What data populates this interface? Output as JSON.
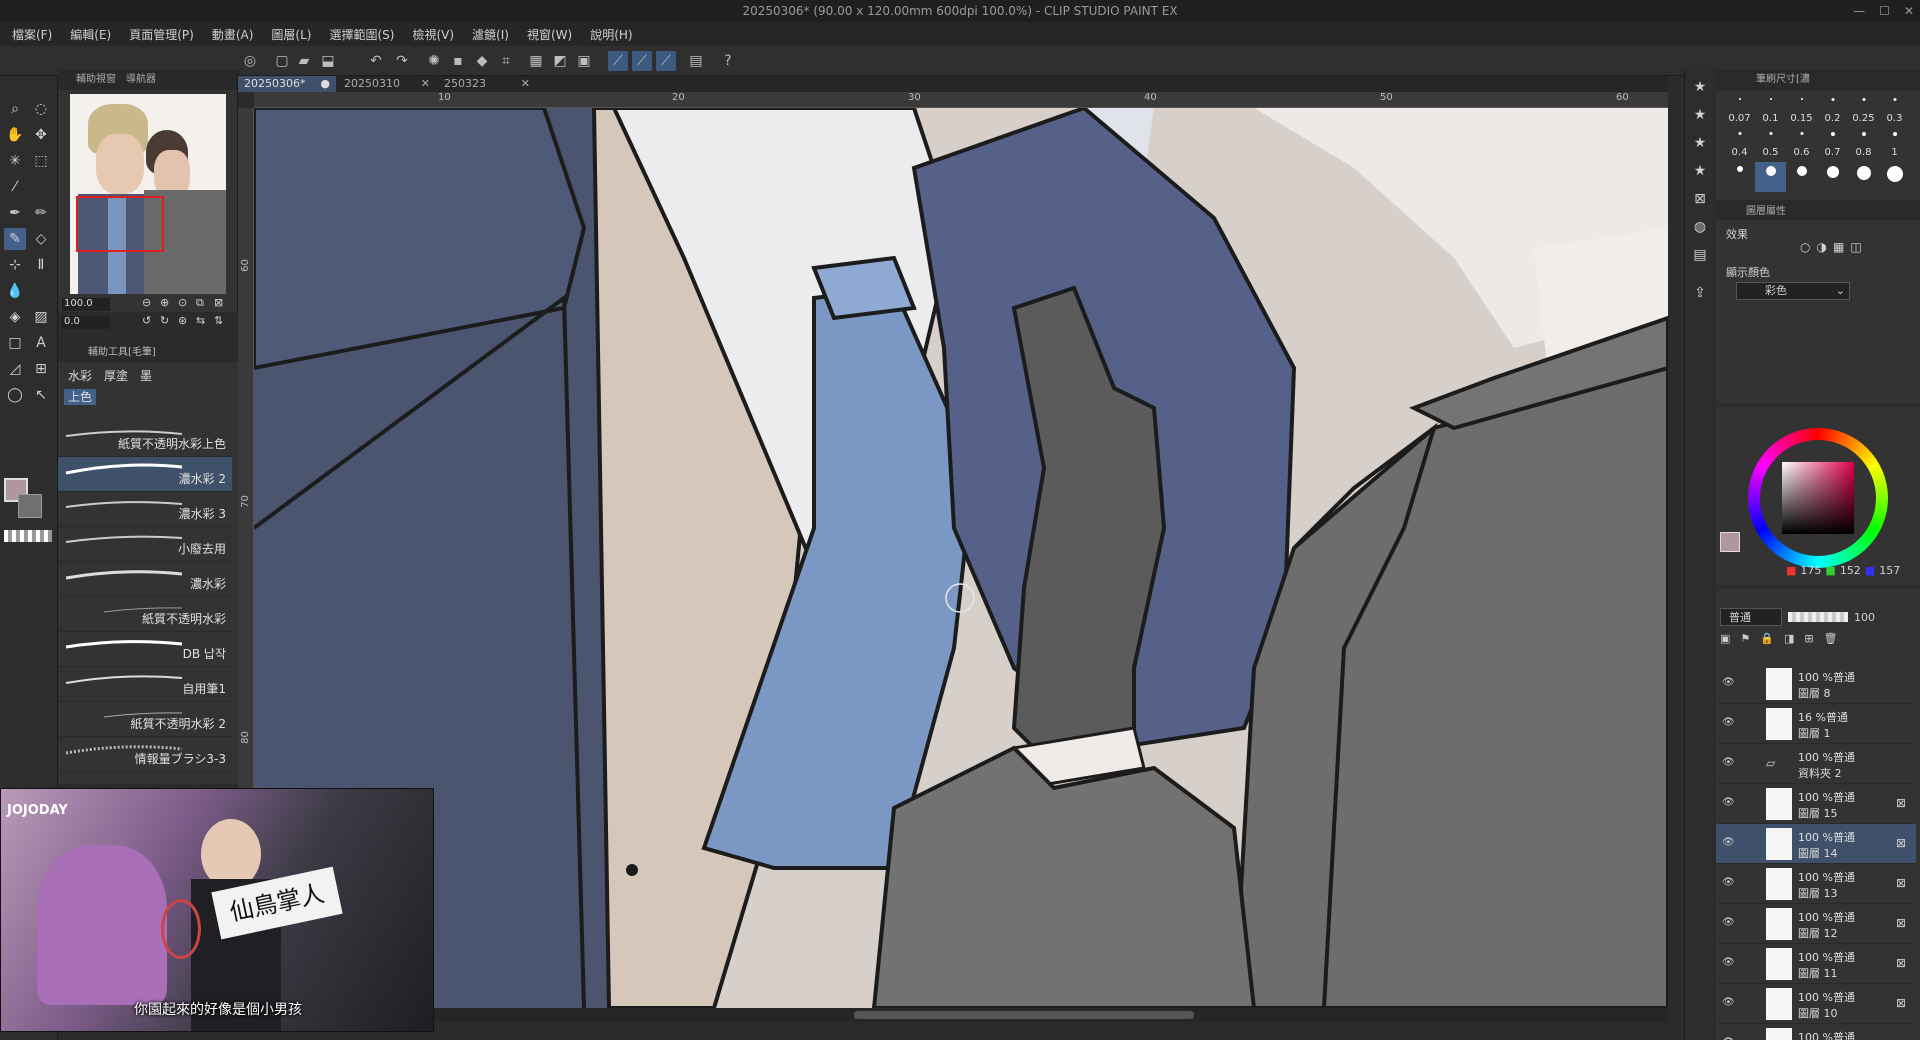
{
  "window": {
    "title": "20250306* (90.00 x 120.00mm 600dpi 100.0%)  - CLIP STUDIO PAINT EX",
    "controls": [
      "—",
      "☐",
      "✕"
    ]
  },
  "menu": [
    "檔案(F)",
    "編輯(E)",
    "頁面管理(P)",
    "動畫(A)",
    "圖層(L)",
    "選擇範圍(S)",
    "檢視(V)",
    "濾鏡(I)",
    "視窗(W)",
    "說明(H)"
  ],
  "navigator": {
    "tabs": [
      "輔助視窗",
      "導航器"
    ],
    "zoom": "100.0",
    "rotate": "0.0"
  },
  "subtool": {
    "header": "輔助工具[毛筆]",
    "tabs": [
      "水彩",
      "厚塗",
      "墨",
      "上色"
    ],
    "brushes": [
      {
        "name": "紙質不透明水彩上色",
        "selected": false
      },
      {
        "name": "濃水彩 2",
        "selected": true
      },
      {
        "name": "濃水彩 3",
        "selected": false
      },
      {
        "name": "小廢去用",
        "selected": false
      },
      {
        "name": "濃水彩",
        "selected": false
      },
      {
        "name": "紙質不透明水彩",
        "selected": false
      },
      {
        "name": "DB 납작",
        "selected": false
      },
      {
        "name": "自用筆1",
        "selected": false
      },
      {
        "name": "紙質不透明水彩 2",
        "selected": false
      },
      {
        "name": "情報量ブラシ3-3",
        "selected": false
      }
    ]
  },
  "doc_tabs": [
    {
      "name": "20250306*",
      "active": true,
      "close": "●"
    },
    {
      "name": "20250310",
      "active": false,
      "close": "✕"
    },
    {
      "name": "250323",
      "active": false,
      "close": "✕"
    }
  ],
  "rulers": {
    "h": [
      "10",
      "20",
      "30",
      "40",
      "50",
      "60"
    ],
    "v": [
      "60",
      "70",
      "80"
    ]
  },
  "video": {
    "logo": "JOJODAY",
    "sign_text": "仙鳥掌人",
    "subtitle": "你園起來的好像是個小男孩"
  },
  "brush_size": {
    "header": "筆刷尺寸[濃",
    "values": [
      "0.07",
      "0.1",
      "0.15",
      "0.2",
      "0.25",
      "0.3",
      "0.4",
      "0.5",
      "0.6",
      "0.7",
      "0.8",
      "1",
      "",
      "",
      "",
      "",
      "",
      ""
    ],
    "selected_index": 13
  },
  "layer_property": {
    "header": "圖層屬性",
    "effect_label": "效果",
    "display_color_label": "顯示顏色",
    "display_color_value": "彩色"
  },
  "color": {
    "r": "175",
    "g": "152",
    "b": "157",
    "current_hex": "#af989d"
  },
  "layers": {
    "blend_mode": "普通",
    "opacity": "100",
    "items": [
      {
        "line1": "100 %普通",
        "line2": "圖層 8",
        "selected": false
      },
      {
        "line1": "16 %普通",
        "line2": "圖層 1",
        "selected": false
      },
      {
        "line1": "100 %普通",
        "line2": "資料夾 2",
        "selected": false,
        "folder": true
      },
      {
        "line1": "100 %普通",
        "line2": "圖層 15",
        "selected": false
      },
      {
        "line1": "100 %普通",
        "line2": "圖層 14",
        "selected": true
      },
      {
        "line1": "100 %普通",
        "line2": "圖層 13",
        "selected": false
      },
      {
        "line1": "100 %普通",
        "line2": "圖層 12",
        "selected": false
      },
      {
        "line1": "100 %普通",
        "line2": "圖層 11",
        "selected": false
      },
      {
        "line1": "100 %普通",
        "line2": "圖層 10",
        "selected": false
      },
      {
        "line1": "100 %普通",
        "line2": "",
        "selected": false
      }
    ]
  }
}
